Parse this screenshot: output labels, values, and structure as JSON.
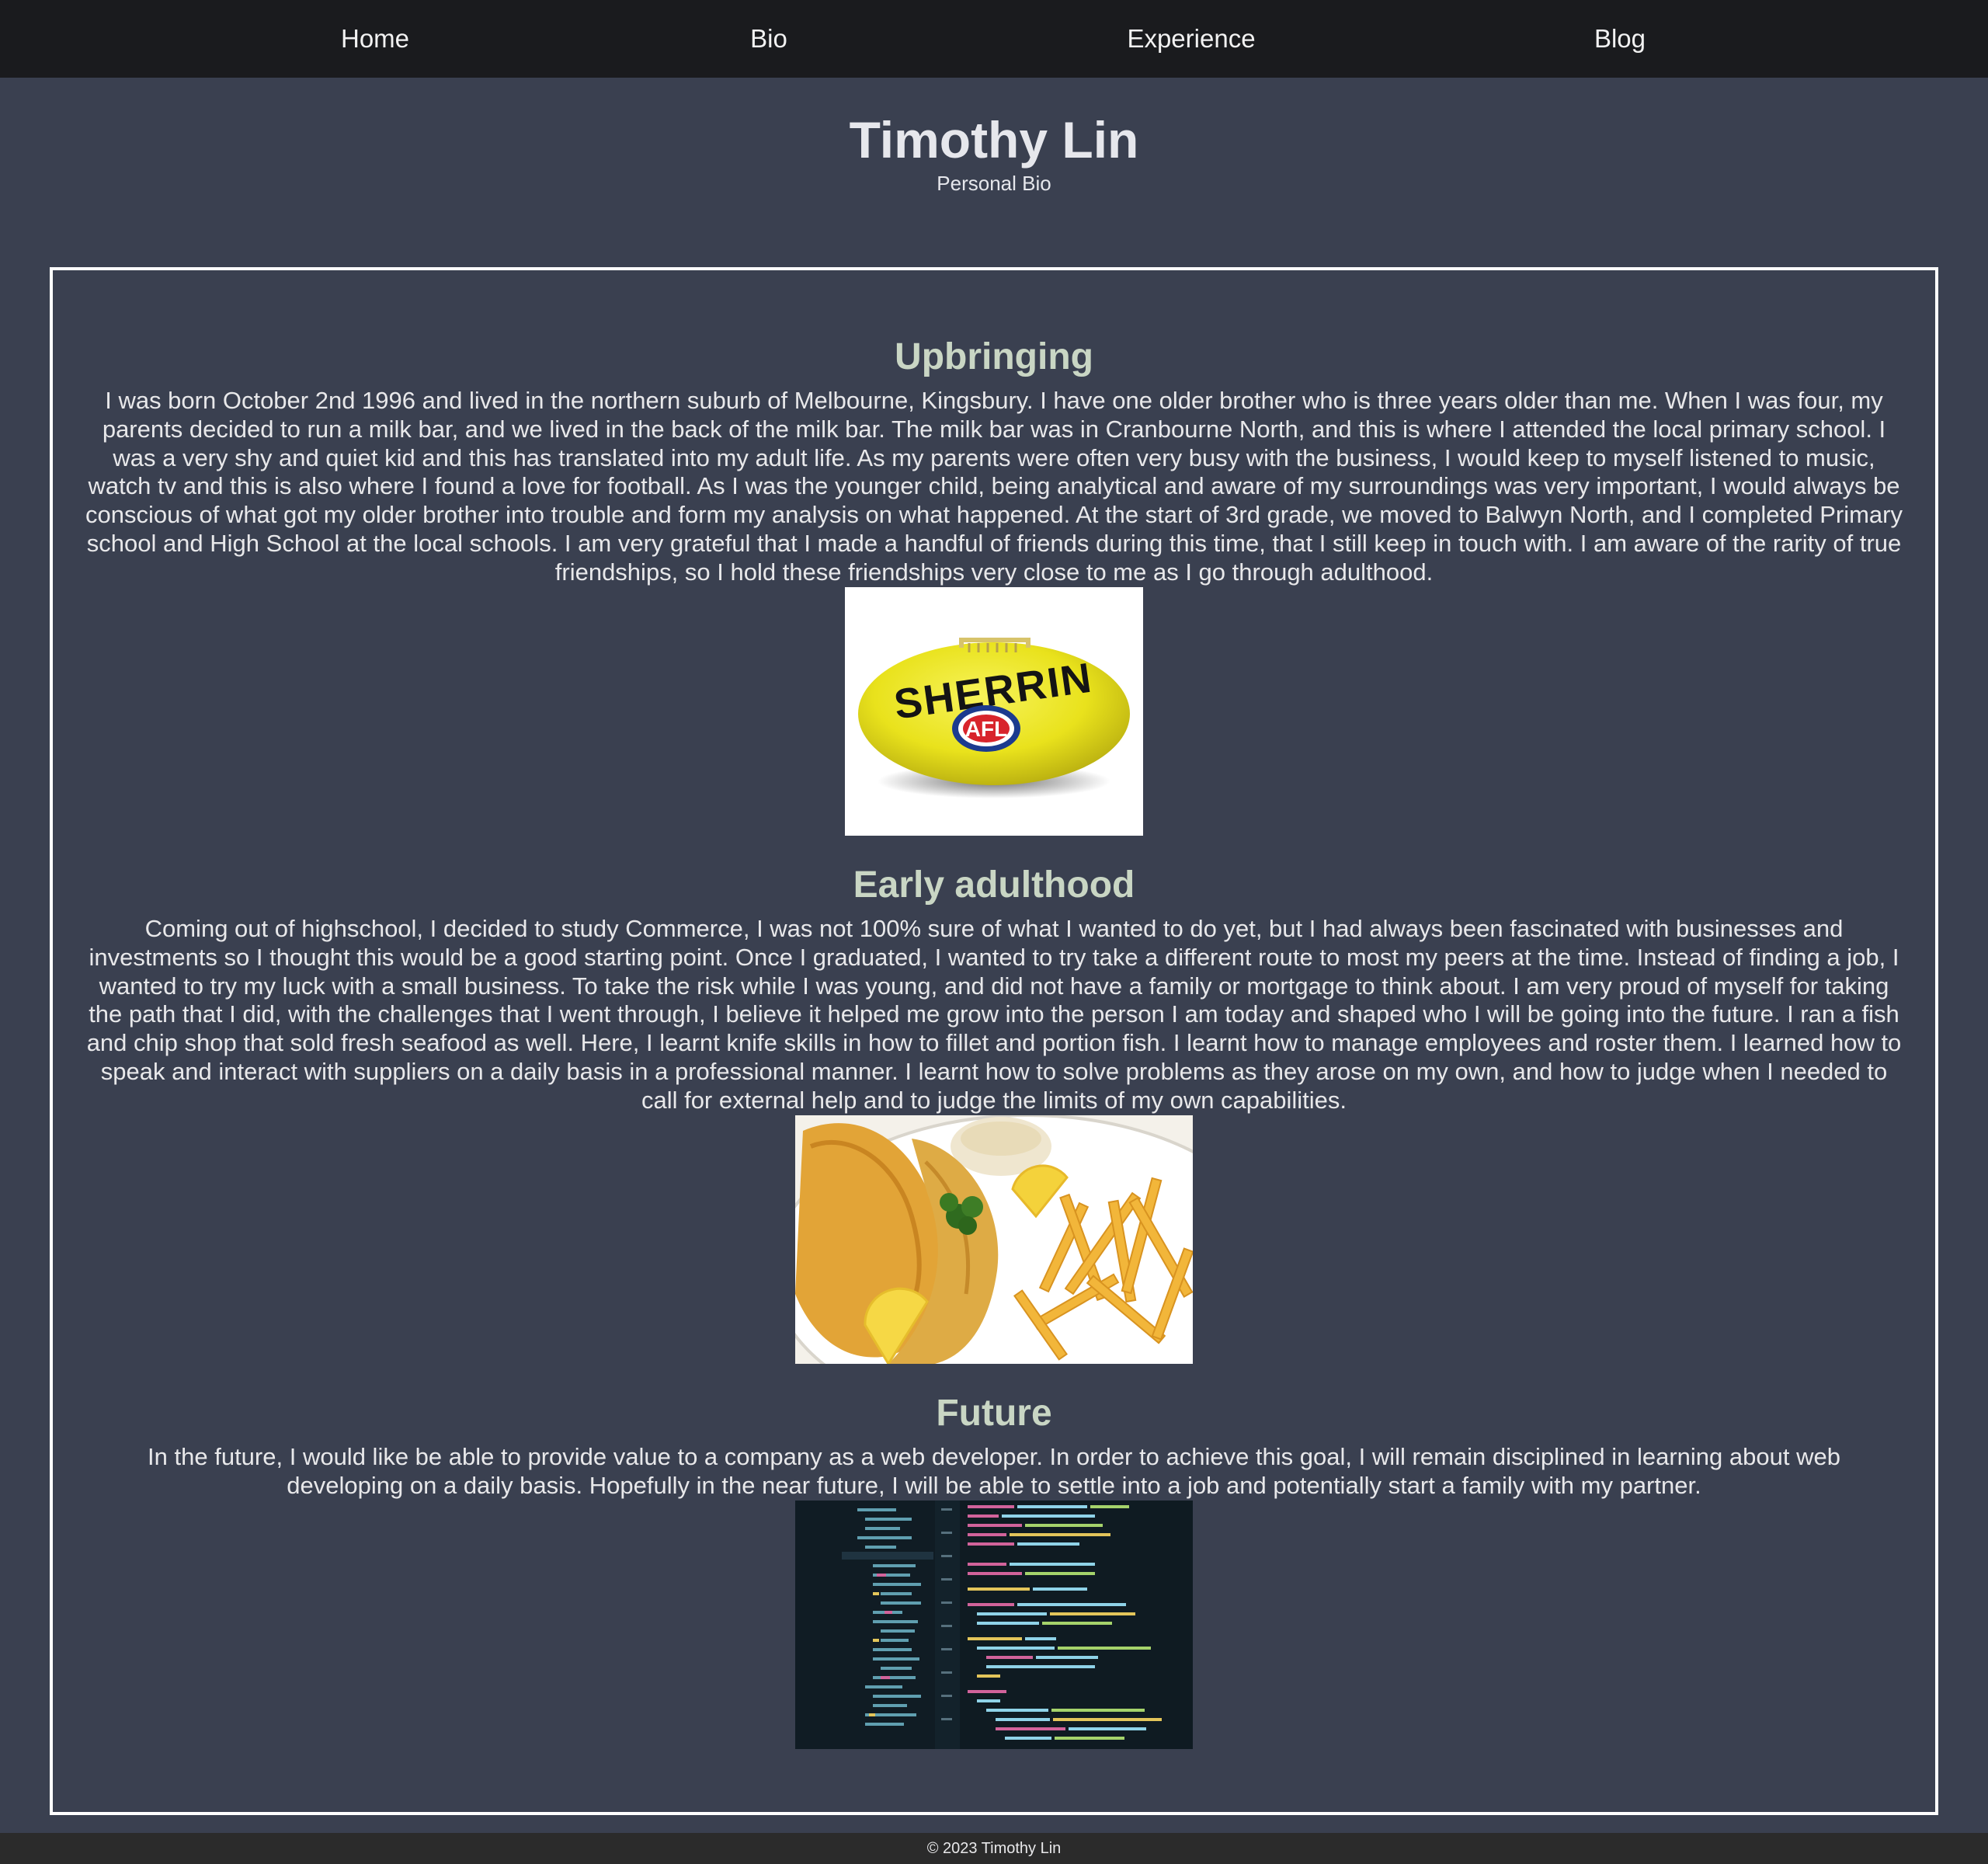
{
  "nav": {
    "items": [
      {
        "label": "Home"
      },
      {
        "label": "Bio"
      },
      {
        "label": "Experience"
      },
      {
        "label": "Blog"
      }
    ]
  },
  "header": {
    "title": "Timothy Lin",
    "subtitle": "Personal Bio"
  },
  "sections": [
    {
      "title": "Upbringing",
      "text": "I was born October 2nd 1996 and lived in the northern suburb of Melbourne, Kingsbury. I have one older brother who is three years older than me. When I was four, my parents decided to run a milk bar, and we lived in the back of the milk bar. The milk bar was in Cranbourne North, and this is where I attended the local primary school. I was a very shy and quiet kid and this has translated into my adult life. As my parents were often very busy with the business, I would keep to myself listened to music, watch tv and this is also where I found a love for football. As I was the younger child, being analytical and aware of my surroundings was very important, I would always be conscious of what got my older brother into trouble and form my analysis on what happened. At the start of 3rd grade, we moved to Balwyn North, and I completed Primary school and High School at the local schools. I am very grateful that I made a handful of friends during this time, that I still keep in touch with. I am aware of the rarity of true friendships, so I hold these friendships very close to me as I go through adulthood.",
      "image_logo_text": "SHERRIN",
      "image_badge_text": "AFL"
    },
    {
      "title": "Early adulthood",
      "text": "Coming out of highschool, I decided to study Commerce, I was not 100% sure of what I wanted to do yet, but I had always been fascinated with businesses and investments so I thought this would be a good starting point. Once I graduated, I wanted to try take a different route to most my peers at the time. Instead of finding a job, I wanted to try my luck with a small business. To take the risk while I was young, and did not have a family or mortgage to think about. I am very proud of myself for taking the path that I did, with the challenges that I went through, I believe it helped me grow into the person I am today and shaped who I will be going into the future. I ran a fish and chip shop that sold fresh seafood as well. Here, I learnt knife skills in how to fillet and portion fish. I learnt how to manage employees and roster them. I learned how to speak and interact with suppliers on a daily basis in a professional manner. I learnt how to solve problems as they arose on my own, and how to judge when I needed to call for external help and to judge the limits of my own capabilities."
    },
    {
      "title": "Future",
      "text": "In the future, I would like be able to provide value to a company as a web developer. In order to achieve this goal, I will remain disciplined in learning about web developing on a daily basis. Hopefully in the near future, I will be able to settle into a job and potentially start a family with my partner."
    }
  ],
  "footer": {
    "text": "© 2023 Timothy Lin"
  },
  "colors": {
    "page_bg": "#3a4050",
    "nav_bg": "#1a1b1e",
    "section_title": "#c9d6c4",
    "footer_bg": "#2b2b2b",
    "box_border": "#ffffff"
  }
}
